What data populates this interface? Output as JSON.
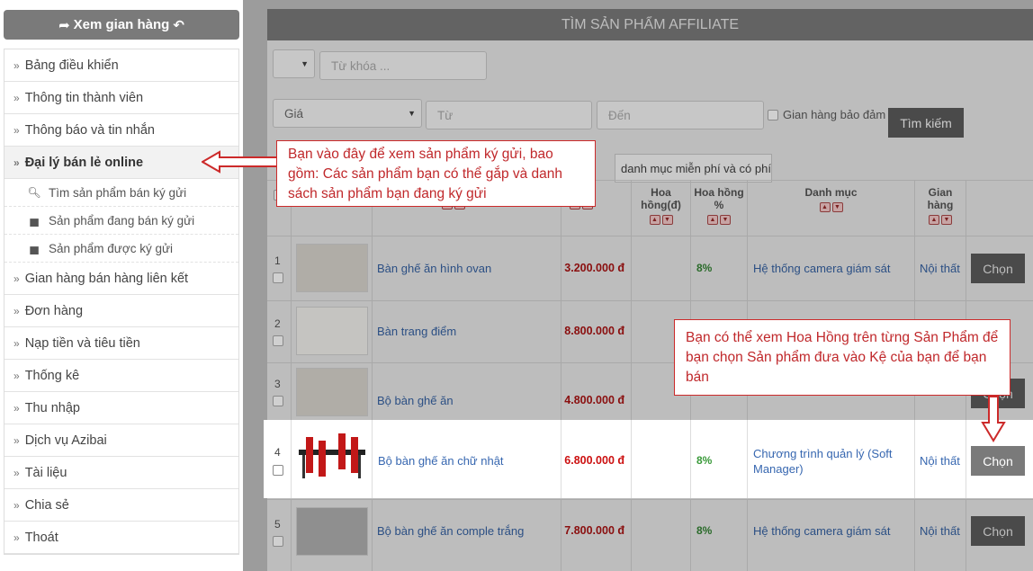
{
  "sidebar": {
    "store_button": "Xem gian hàng",
    "menu": [
      {
        "label": "Bảng điều khiển"
      },
      {
        "label": "Thông tin thành viên"
      },
      {
        "label": "Thông báo và tin nhắn"
      },
      {
        "label": "Đại lý bán lẻ online"
      },
      {
        "label": "Gian hàng bán hàng liên kết"
      },
      {
        "label": "Đơn hàng"
      },
      {
        "label": "Nạp tiền và tiêu tiền"
      },
      {
        "label": "Thống kê"
      },
      {
        "label": "Thu nhập"
      },
      {
        "label": "Dịch vụ Azibai"
      },
      {
        "label": "Tài liệu"
      },
      {
        "label": "Chia sẻ"
      },
      {
        "label": "Thoát"
      }
    ],
    "submenu": [
      {
        "label": "Tìm sản phẩm bán ký gửi",
        "icon": "search-icon"
      },
      {
        "label": "Sản phẩm đang bán ký gửi",
        "icon": "bag-icon"
      },
      {
        "label": "Sản phẩm được ký gửi",
        "icon": "bag-icon"
      }
    ]
  },
  "panel": {
    "title": "TÌM SẢN PHẨM AFFILIATE",
    "keyword_placeholder": "Từ khóa ...",
    "price_select": "Giá",
    "from_placeholder": "Từ",
    "to_placeholder": "Đến",
    "guarantee_label": "Gian hàng bảo đảm",
    "search_button": "Tìm kiếm",
    "category_button": "danh mục miễn phí và có phí"
  },
  "table": {
    "headers": {
      "commission_amount": "Hoa hồng(đ)",
      "commission_pct": "Hoa hồng %",
      "category": "Danh mục",
      "store": "Gian hàng"
    },
    "rows": [
      {
        "num": "1",
        "name": "Bàn ghế ăn hình ovan",
        "price": "3.200.000 đ",
        "pct": "8%",
        "category": "Hệ thống camera giám sát",
        "store": "Nội thất",
        "action": "Chọn"
      },
      {
        "num": "2",
        "name": "Bàn trang điểm",
        "price": "8.800.000 đ",
        "pct": "",
        "category": "",
        "store": "",
        "action": "Chọn"
      },
      {
        "num": "3",
        "name": "Bộ bàn ghế ăn",
        "price": "4.800.000 đ",
        "pct": "",
        "category": "",
        "store": "",
        "action": "Chọn"
      },
      {
        "num": "4",
        "name": "Bộ bàn ghế ăn chữ nhật",
        "price": "6.800.000 đ",
        "pct": "8%",
        "category": "Chương trình quản lý (Soft Manager)",
        "store": "Nội thất",
        "action": "Chọn"
      },
      {
        "num": "5",
        "name": "Bộ bàn ghế ăn comple trắng",
        "price": "7.800.000 đ",
        "pct": "8%",
        "category": "Hệ thống camera giám sát",
        "store": "Nội thất",
        "action": "Chọn"
      }
    ]
  },
  "callouts": {
    "left": "Bạn vào đây để xem sản phẩm ký gửi, bao gồm: Các sản phẩm bạn có thể gắp và danh sách sản phẩm bạn đang ký gửi",
    "right": "Bạn có thể xem Hoa Hồng trên từng Sản Phẩm để bạn chọn Sản phẩm đưa vào Kệ của bạn để bạn bán"
  },
  "colors": {
    "callout_red": "#c0282b",
    "price_red": "#cc1010",
    "link_blue": "#3767b0",
    "pct_green": "#3a9a3a"
  }
}
